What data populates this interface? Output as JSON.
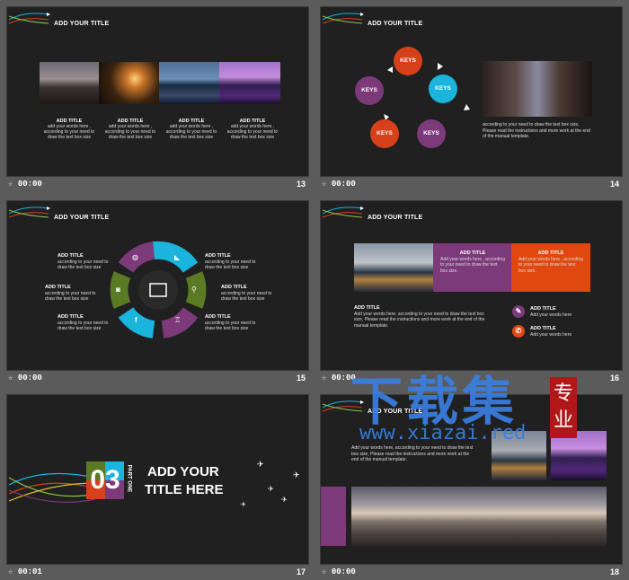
{
  "slides": [
    {
      "title": "ADD YOUR TITLE",
      "time": "00:00",
      "num": "13",
      "captions": [
        {
          "head": "ADD TITLE",
          "body": "add your words here , according to your need to draw the text box size"
        },
        {
          "head": "ADD TITLE",
          "body": "add your words here , according to your need to draw the text box size"
        },
        {
          "head": "ADD TITLE",
          "body": "add your words here , according to your need to draw the text box size"
        },
        {
          "head": "ADD TITLE",
          "body": "add your words here , according to your need to draw the text box size"
        }
      ]
    },
    {
      "title": "ADD YOUR TITLE",
      "time": "00:00",
      "num": "14",
      "keys": [
        "KEYS",
        "KEYS",
        "KEYS",
        "KEYS",
        "KEYS"
      ],
      "body": "according to your need to draw the text box size, Please read the instructions and more work at the end of the manual template."
    },
    {
      "title": "ADD YOUR TITLE",
      "time": "00:00",
      "num": "15",
      "items": [
        {
          "head": "ADD TITLE",
          "body": "according to your need to draw the text box size"
        },
        {
          "head": "ADD TITLE",
          "body": "according to your need to draw the text box size"
        },
        {
          "head": "ADD TITLE",
          "body": "according to your need to draw the text box size"
        },
        {
          "head": "ADD TITLE",
          "body": "according to your need to draw the text box size"
        },
        {
          "head": "ADD TITLE",
          "body": "according to your need to draw the text box size"
        },
        {
          "head": "ADD TITLE",
          "body": "according to your need to draw the text box size"
        }
      ]
    },
    {
      "title": "ADD YOUR TITLE",
      "time": "00:00",
      "num": "16",
      "box1": {
        "head": "ADD TITLE",
        "body": "Add your words here , according to your need to draw the text box size."
      },
      "box2": {
        "head": "ADD TITLE",
        "body": "Add your words here , according to your need to draw the text box size."
      },
      "main": {
        "head": "ADD TITLE",
        "body": "Add your words here, according to your need to draw the text box size, Please read the instructions and more work at the end of the manual template."
      },
      "side": [
        {
          "head": "ADD TITLE",
          "body": "Add your words here"
        },
        {
          "head": "ADD TITLE",
          "body": "Add your words here"
        }
      ]
    },
    {
      "time": "00:01",
      "num": "17",
      "number": "03",
      "part": "PART ONE",
      "line1": "ADD YOUR",
      "line2": "TITLE HERE"
    },
    {
      "title": "ADD YOUR TITLE",
      "time": "00:00",
      "num": "18",
      "body": "Add your words here, according to your need to draw the text box size, Please read the instructions and more work at the end of the manual template."
    }
  ],
  "watermark": {
    "big": "下载集",
    "url": "www.xiazai.red",
    "seal": "专业"
  },
  "colors": {
    "red": "#d6401a",
    "cyan": "#1ab4dc",
    "purple": "#7c3a7a",
    "green": "#5a7a24",
    "orange": "#e0480f"
  }
}
